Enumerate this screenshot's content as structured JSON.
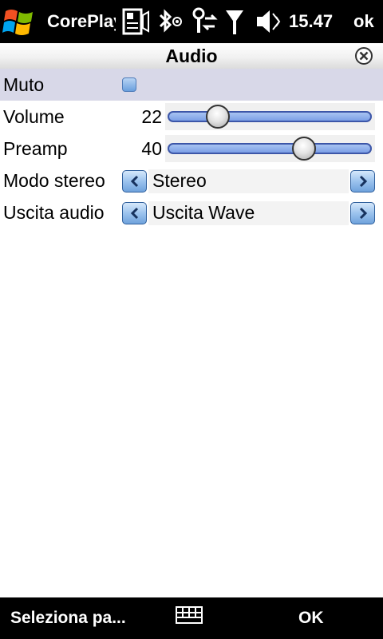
{
  "status_bar": {
    "app_title": "CorePlayer",
    "clock": "15.47",
    "ok_label": "ok",
    "icons": [
      "windows-start-icon",
      "notification-icon",
      "bluetooth-icon",
      "activesync-icon",
      "signal-icon",
      "volume-icon"
    ]
  },
  "title_bar": {
    "title": "Audio",
    "close_icon": "close-icon"
  },
  "settings": {
    "muto": {
      "label": "Muto",
      "checked": false
    },
    "volume": {
      "label": "Volume",
      "value": "22",
      "level": 0.24
    },
    "preamp": {
      "label": "Preamp",
      "value": "40",
      "level": 0.67
    },
    "stereo": {
      "label": "Modo stereo",
      "value": "Stereo"
    },
    "uscita": {
      "label": "Uscita audio",
      "value": "Uscita Wave"
    }
  },
  "softkeys": {
    "left": "Seleziona pa...",
    "center_icon": "keyboard-icon",
    "right": "OK"
  },
  "colors": {
    "accent": "#7c9fe6",
    "selected_row": "#d8d8e8",
    "bar_bg": "#000000"
  }
}
